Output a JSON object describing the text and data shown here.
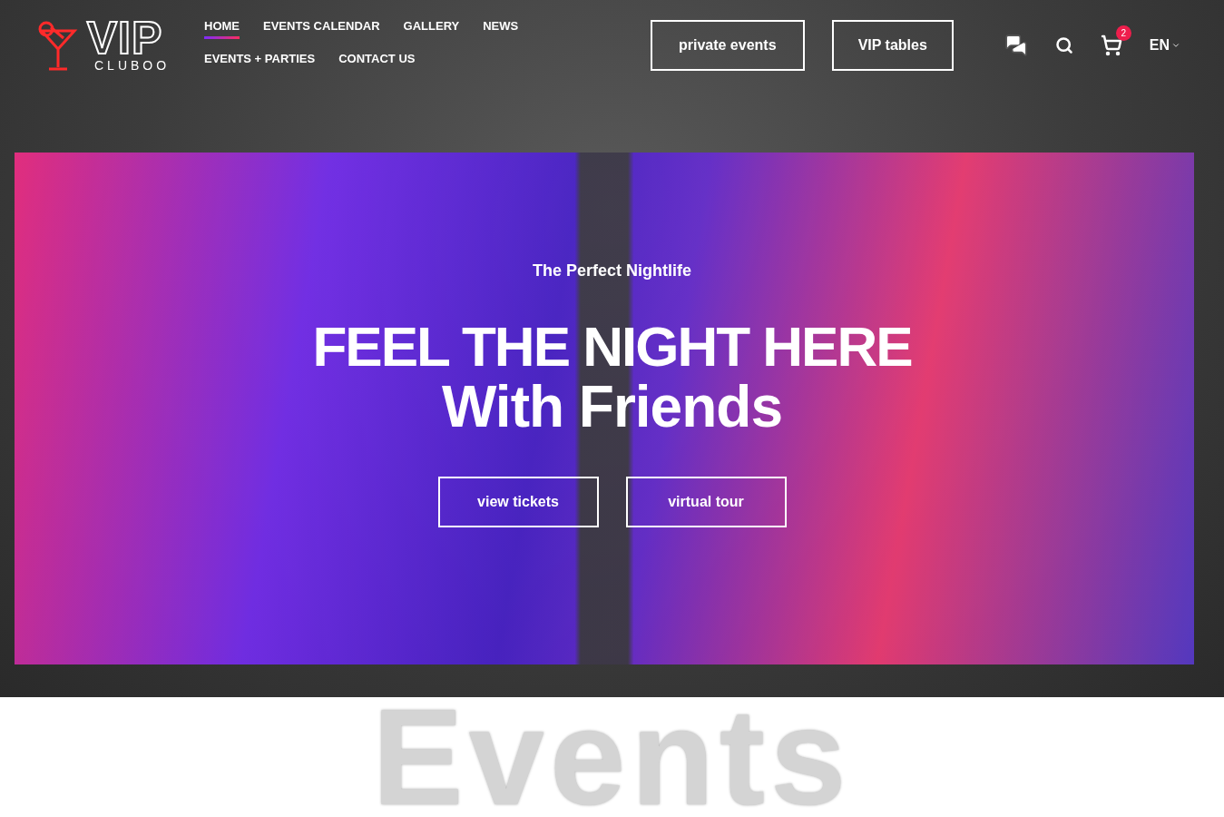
{
  "logo": {
    "word": "VIP",
    "sub": "CLUBOO"
  },
  "nav": [
    {
      "label": "HOME",
      "selected": true
    },
    {
      "label": "EVENTS CALENDAR",
      "selected": false
    },
    {
      "label": "GALLERY",
      "selected": false
    },
    {
      "label": "NEWS",
      "selected": false
    },
    {
      "label": "EVENTS + PARTIES",
      "selected": false
    },
    {
      "label": "CONTACT US",
      "selected": false
    }
  ],
  "header_buttons": [
    "private events",
    "VIP tables"
  ],
  "cart": {
    "count": "2"
  },
  "language": "EN",
  "hero": {
    "eyebrow": "The Perfect Nightlife",
    "title": "FEEL THE NIGHT HERE",
    "subtitle": "With Friends",
    "buttons": [
      "view tickets",
      "virtual tour"
    ]
  },
  "section_heading": "Events"
}
